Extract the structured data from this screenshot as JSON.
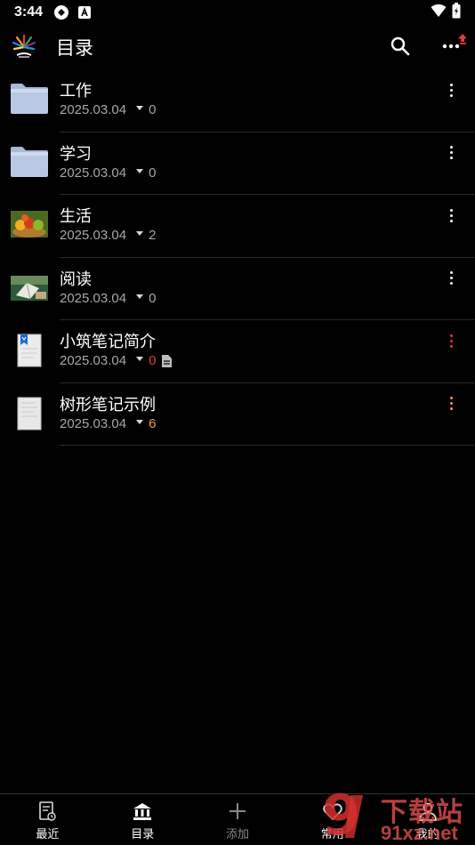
{
  "status_bar": {
    "time": "3:44"
  },
  "app_bar": {
    "title": "目录"
  },
  "items": [
    {
      "name": "工作",
      "date": "2025.03.04",
      "count": "0",
      "count_color": "#a8a8a8",
      "menu_color": "#ffffff",
      "icon": "folder-icon",
      "has_doc_badge": false
    },
    {
      "name": "学习",
      "date": "2025.03.04",
      "count": "0",
      "count_color": "#a8a8a8",
      "menu_color": "#ffffff",
      "icon": "folder-icon",
      "has_doc_badge": false
    },
    {
      "name": "生活",
      "date": "2025.03.04",
      "count": "2",
      "count_color": "#a8a8a8",
      "menu_color": "#ffffff",
      "icon": "fruit-bowl-icon",
      "has_doc_badge": false
    },
    {
      "name": "阅读",
      "date": "2025.03.04",
      "count": "0",
      "count_color": "#a8a8a8",
      "menu_color": "#ffffff",
      "icon": "reading-photo-icon",
      "has_doc_badge": false
    },
    {
      "name": "小筑笔记简介",
      "date": "2025.03.04",
      "count": "0",
      "count_color": "#e53935",
      "menu_color": "#e53935",
      "icon": "bookmarked-note-icon",
      "has_doc_badge": true
    },
    {
      "name": "树形笔记示例",
      "date": "2025.03.04",
      "count": "6",
      "count_color": "#f0a030",
      "menu_color": "#f0a030",
      "icon": "note-page-icon",
      "has_doc_badge": false
    }
  ],
  "bottom_nav": [
    {
      "label": "最近",
      "icon": "recent-note-icon",
      "active": false
    },
    {
      "label": "目录",
      "icon": "library-icon",
      "active": true
    },
    {
      "label": "添加",
      "icon": "plus-icon",
      "active": false
    },
    {
      "label": "常用",
      "icon": "heart-icon",
      "active": false
    },
    {
      "label": "我的",
      "icon": "user-icon",
      "active": false
    }
  ],
  "watermark": {
    "text_cn": "下载站",
    "text_en": "91xz.net",
    "mark": "9"
  },
  "colors": {
    "background": "#000000",
    "text": "#ffffff",
    "muted": "#a8a8a8",
    "accent_red": "#e53935",
    "accent_orange": "#f0a030",
    "upload_red": "#e53935"
  }
}
